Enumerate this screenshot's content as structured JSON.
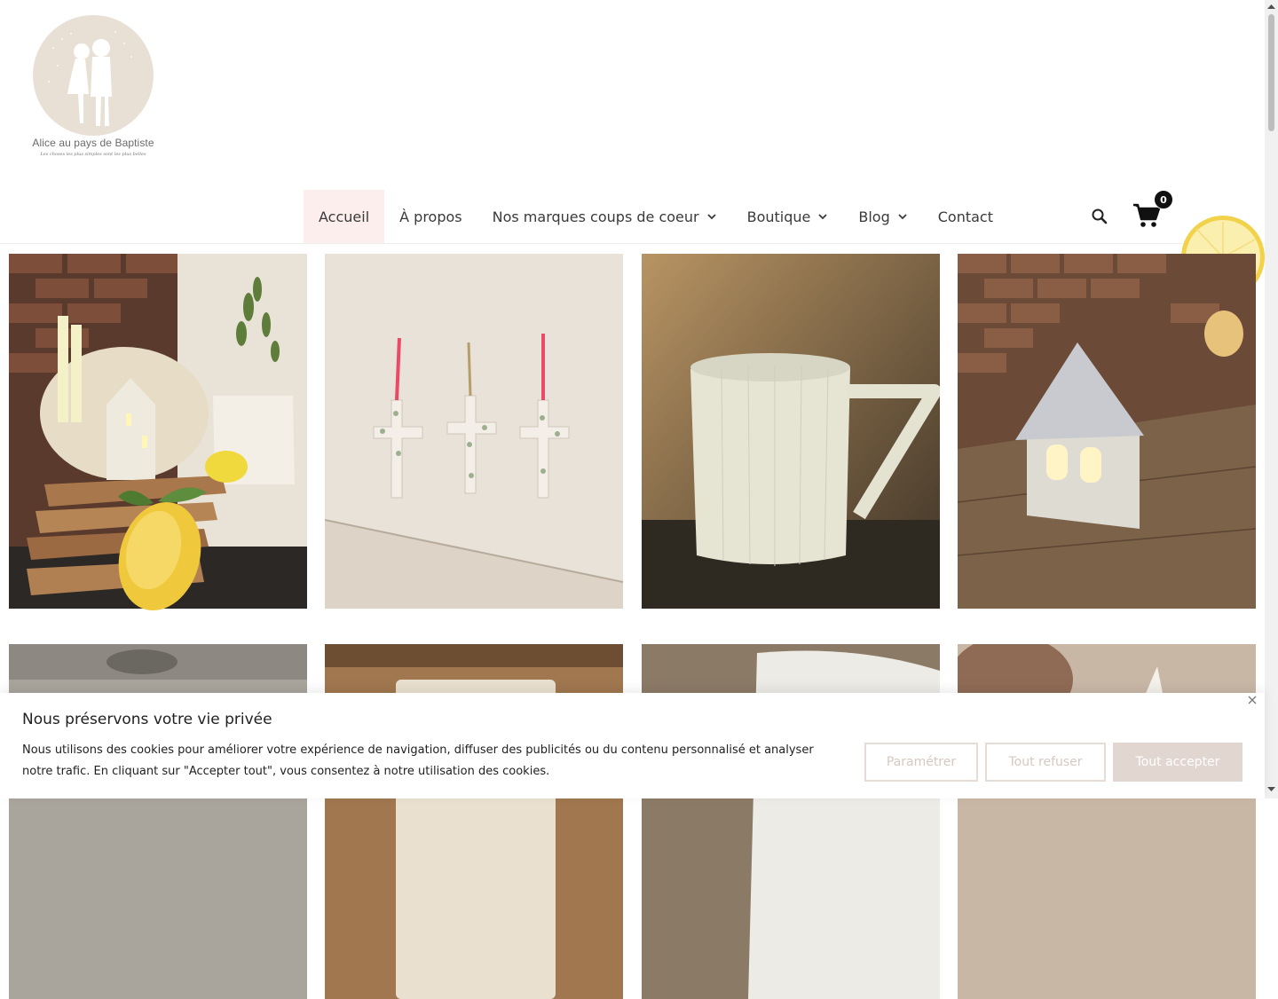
{
  "brand": {
    "name": "Alice au pays de Baptiste",
    "tagline": "Les choses les plus simples sont les plus belles"
  },
  "nav": {
    "items": [
      {
        "label": "Accueil",
        "active": true
      },
      {
        "label": "À propos"
      },
      {
        "label": "Nos marques coups de coeur",
        "has_dropdown": true
      },
      {
        "label": "Boutique",
        "has_dropdown": true
      },
      {
        "label": "Blog",
        "has_dropdown": true
      },
      {
        "label": "Contact"
      }
    ]
  },
  "header_icons": {
    "search": "search-icon",
    "cart": "cart-icon",
    "cart_count": "0"
  },
  "products": [
    {
      "alt": "Bougies, maison lumineuse, planches en bois et citrons"
    },
    {
      "alt": "Trois croix en céramique fleurie"
    },
    {
      "alt": "Pichet en porcelaine blanche"
    },
    {
      "alt": "Maison lumineuse en porcelaine"
    },
    {
      "alt": ""
    },
    {
      "alt": ""
    },
    {
      "alt": ""
    },
    {
      "alt": ""
    }
  ],
  "cookie": {
    "title": "Nous préservons votre vie privée",
    "text": "Nous utilisons des cookies pour améliorer votre expérience de navigation, diffuser des publicités ou du contenu personnalisé et analyser notre trafic. En cliquant sur \"Accepter tout\", vous consentez à notre utilisation des cookies.",
    "settings_label": "Paramétrer",
    "reject_label": "Tout refuser",
    "accept_label": "Tout accepter"
  },
  "colors": {
    "accent_bg": "#fbeeec",
    "button_fill": "#e1d6d0",
    "button_border": "#e6dcd6"
  }
}
